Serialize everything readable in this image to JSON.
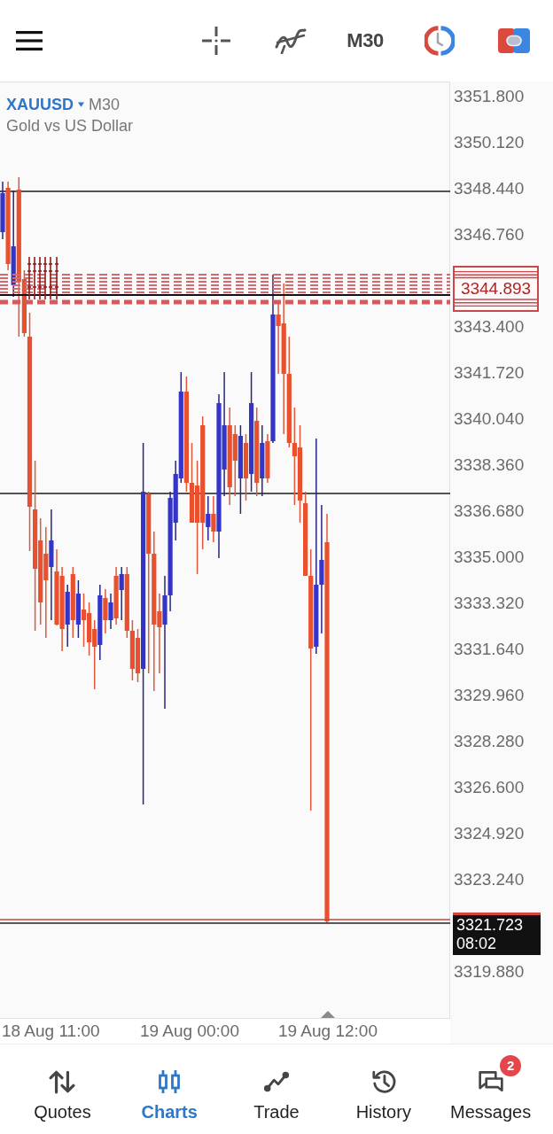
{
  "toolbar": {
    "timeframe": "M30"
  },
  "chart": {
    "symbol": "XAUUSD",
    "timeframe": "M30",
    "description": "Gold vs US Dollar",
    "price_scale": [
      {
        "kind": "tick",
        "text": "3351.800"
      },
      {
        "kind": "tick",
        "text": "3350.120"
      },
      {
        "kind": "tick",
        "text": "3348.440"
      },
      {
        "kind": "tick",
        "text": "3346.760"
      },
      {
        "kind": "order_levels",
        "text": "3344.893"
      },
      {
        "kind": "tick",
        "text": "3343.400"
      },
      {
        "kind": "tick",
        "text": "3341.720"
      },
      {
        "kind": "tick",
        "text": "3340.040"
      },
      {
        "kind": "tick",
        "text": "3338.360"
      },
      {
        "kind": "tick",
        "text": "3336.680"
      },
      {
        "kind": "tick",
        "text": "3335.000"
      },
      {
        "kind": "tick",
        "text": "3333.320"
      },
      {
        "kind": "tick",
        "text": "3331.640"
      },
      {
        "kind": "tick",
        "text": "3329.960"
      },
      {
        "kind": "tick",
        "text": "3328.280"
      },
      {
        "kind": "tick",
        "text": "3326.600"
      },
      {
        "kind": "tick",
        "text": "3324.920"
      },
      {
        "kind": "tick",
        "text": "3323.240"
      },
      {
        "kind": "current_price",
        "text": "3321.723",
        "time": "08:02"
      },
      {
        "kind": "tick",
        "text": "3319.880"
      }
    ],
    "time_scale": [
      "18 Aug 11:00",
      "19 Aug 00:00",
      "19 Aug 12:00"
    ]
  },
  "bottom_nav": [
    {
      "label": "Quotes",
      "selected": false
    },
    {
      "label": "Charts",
      "selected": true
    },
    {
      "label": "Trade",
      "selected": false
    },
    {
      "label": "History",
      "selected": false
    },
    {
      "label": "Messages",
      "selected": false,
      "badge": "2"
    }
  ]
}
